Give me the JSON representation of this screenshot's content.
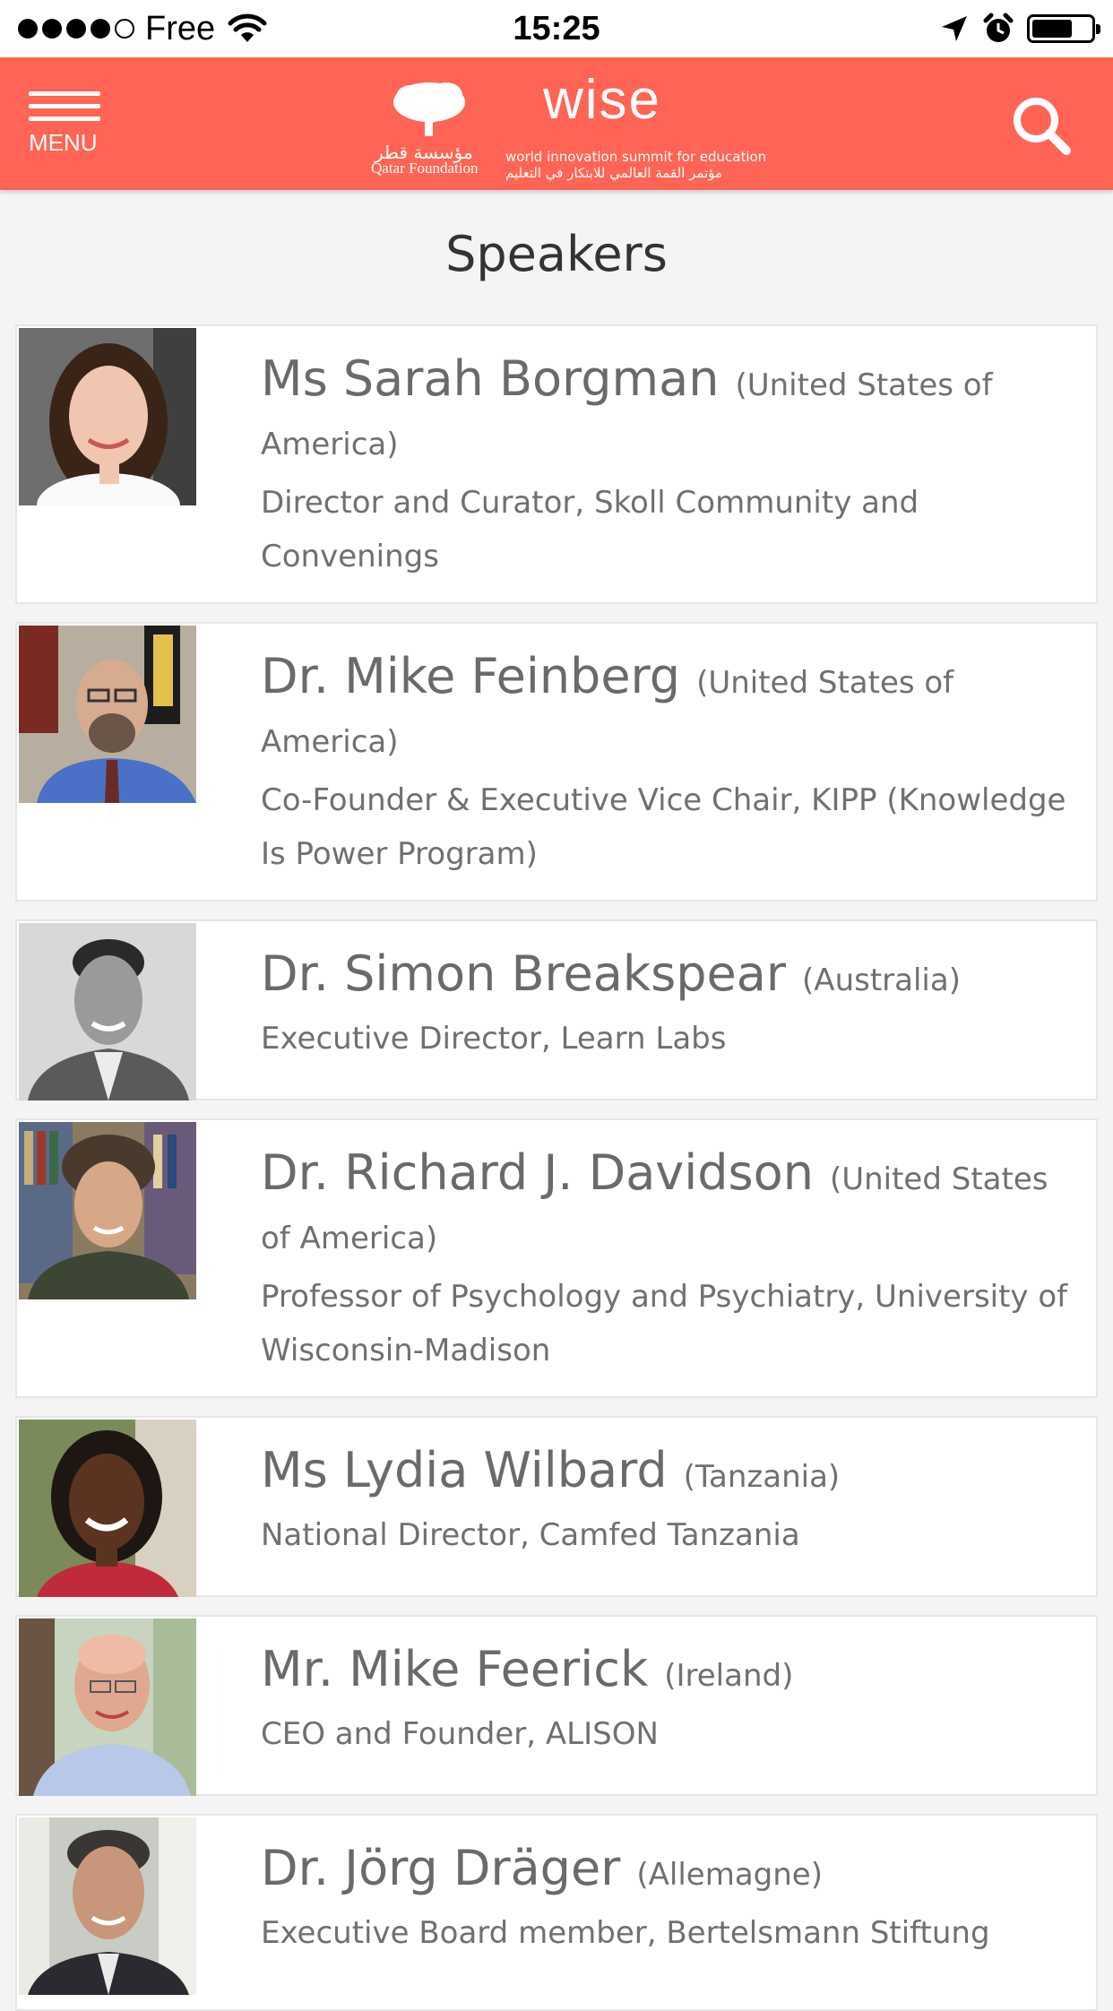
{
  "status_bar": {
    "carrier": "Free",
    "time": "15:25",
    "signal_filled": 4,
    "signal_total": 5,
    "battery_level": 0.68
  },
  "header": {
    "menu_label": "MENU",
    "qf_arabic": "مؤسسة قطر",
    "qf_label": "Qatar Foundation",
    "wise_word": "wise",
    "wise_sub": "world innovation summit for education",
    "wise_arabic": "مؤتمر القمة العالمي للابتكار في التعليم",
    "background_color": "#ff6454",
    "search_icon": "search-icon",
    "menu_icon": "hamburger-icon"
  },
  "page": {
    "title": "Speakers"
  },
  "speakers": [
    {
      "name": "Ms Sarah Borgman",
      "country": "(United States of America)",
      "role": "Director and Curator, Skoll Community and Convenings",
      "photo": "portrait-sarah-borgman"
    },
    {
      "name": "Dr. Mike Feinberg",
      "country": "(United States of America)",
      "role": "Co-Founder & Executive Vice Chair, KIPP (Knowledge Is Power Program)",
      "photo": "portrait-mike-feinberg"
    },
    {
      "name": "Dr. Simon Breakspear",
      "country": "(Australia)",
      "role": "Executive Director, Learn Labs",
      "photo": "portrait-simon-breakspear"
    },
    {
      "name": "Dr. Richard J. Davidson",
      "country": "(United States of America)",
      "role": "Professor of Psychology and Psychiatry, University of Wisconsin-Madison",
      "photo": "portrait-richard-davidson"
    },
    {
      "name": "Ms Lydia Wilbard",
      "country": "(Tanzania)",
      "role": "National Director, Camfed Tanzania",
      "photo": "portrait-lydia-wilbard"
    },
    {
      "name": "Mr. Mike Feerick",
      "country": "(Ireland)",
      "role": "CEO and Founder, ALISON",
      "photo": "portrait-mike-feerick"
    },
    {
      "name": "Dr. Jörg Dräger",
      "country": "(Allemagne)",
      "role": "Executive Board member, Bertelsmann Stiftung",
      "photo": "portrait-jorg-drager"
    }
  ]
}
